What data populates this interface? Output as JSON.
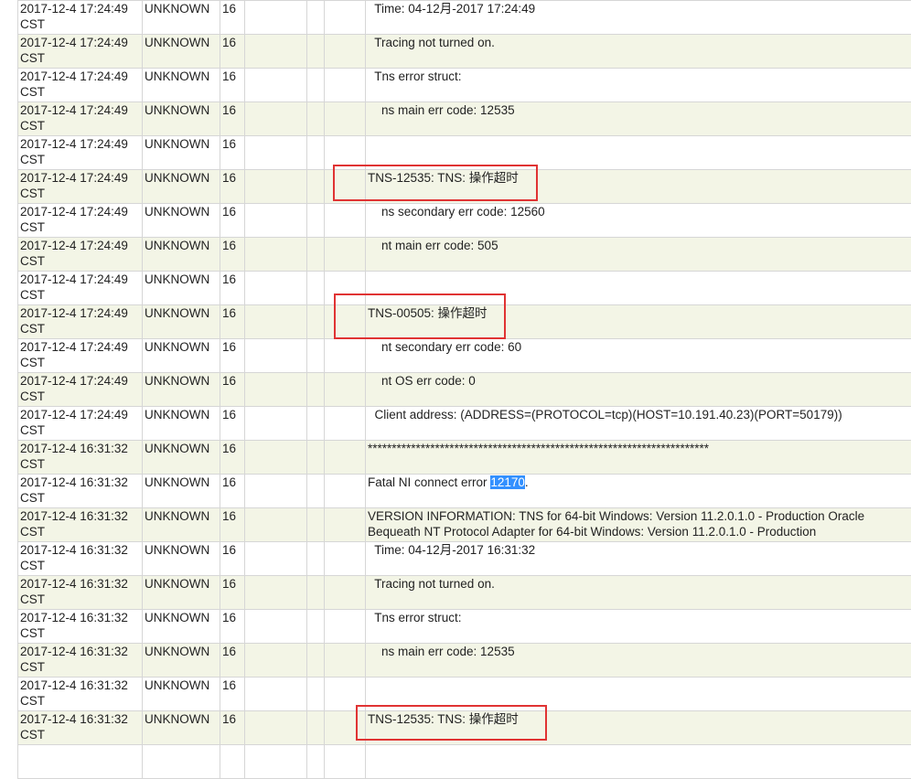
{
  "rows": [
    {
      "time": "2017-12-4 17:24:49 CST",
      "source": "UNKNOWN",
      "level": "16",
      "message": "  Time: 04-12月-2017 17:24:49"
    },
    {
      "time": "2017-12-4 17:24:49 CST",
      "source": "UNKNOWN",
      "level": "16",
      "message": "  Tracing not turned on."
    },
    {
      "time": "2017-12-4 17:24:49 CST",
      "source": "UNKNOWN",
      "level": "16",
      "message": "  Tns error struct:"
    },
    {
      "time": "2017-12-4 17:24:49 CST",
      "source": "UNKNOWN",
      "level": "16",
      "message": "    ns main err code: 12535"
    },
    {
      "time": "2017-12-4 17:24:49 CST",
      "source": "UNKNOWN",
      "level": "16",
      "message": ""
    },
    {
      "time": "2017-12-4 17:24:49 CST",
      "source": "UNKNOWN",
      "level": "16",
      "message": "TNS-12535: TNS: 操作超时"
    },
    {
      "time": "2017-12-4 17:24:49 CST",
      "source": "UNKNOWN",
      "level": "16",
      "message": "    ns secondary err code: 12560"
    },
    {
      "time": "2017-12-4 17:24:49 CST",
      "source": "UNKNOWN",
      "level": "16",
      "message": "    nt main err code: 505"
    },
    {
      "time": "2017-12-4 17:24:49 CST",
      "source": "UNKNOWN",
      "level": "16",
      "message": ""
    },
    {
      "time": "2017-12-4 17:24:49 CST",
      "source": "UNKNOWN",
      "level": "16",
      "message": "TNS-00505: 操作超时"
    },
    {
      "time": "2017-12-4 17:24:49 CST",
      "source": "UNKNOWN",
      "level": "16",
      "message": "    nt secondary err code: 60"
    },
    {
      "time": "2017-12-4 17:24:49 CST",
      "source": "UNKNOWN",
      "level": "16",
      "message": "    nt OS err code: 0"
    },
    {
      "time": "2017-12-4 17:24:49 CST",
      "source": "UNKNOWN",
      "level": "16",
      "message": "  Client address: (ADDRESS=(PROTOCOL=tcp)(HOST=10.191.40.23)(PORT=50179))"
    },
    {
      "time": "2017-12-4 16:31:32 CST",
      "source": "UNKNOWN",
      "level": "16",
      "message": "***********************************************************************"
    },
    {
      "time": "2017-12-4 16:31:32 CST",
      "source": "UNKNOWN",
      "level": "16",
      "message_prefix": "Fatal NI connect error ",
      "message_highlight": "12170",
      "message_suffix": "."
    },
    {
      "time": "2017-12-4 16:31:32 CST",
      "source": "UNKNOWN",
      "level": "16",
      "message": "  VERSION INFORMATION: TNS for 64-bit Windows: Version 11.2.0.1.0 - Production Oracle Bequeath NT Protocol Adapter for 64-bit Windows: Version 11.2.0.1.0 - Production"
    },
    {
      "time": "2017-12-4 16:31:32 CST",
      "source": "UNKNOWN",
      "level": "16",
      "message": "  Time: 04-12月-2017 16:31:32"
    },
    {
      "time": "2017-12-4 16:31:32 CST",
      "source": "UNKNOWN",
      "level": "16",
      "message": "  Tracing not turned on."
    },
    {
      "time": "2017-12-4 16:31:32 CST",
      "source": "UNKNOWN",
      "level": "16",
      "message": "  Tns error struct:"
    },
    {
      "time": "2017-12-4 16:31:32 CST",
      "source": "UNKNOWN",
      "level": "16",
      "message": "    ns main err code: 12535"
    },
    {
      "time": "2017-12-4 16:31:32 CST",
      "source": "UNKNOWN",
      "level": "16",
      "message": ""
    },
    {
      "time": "2017-12-4 16:31:32 CST",
      "source": "UNKNOWN",
      "level": "16",
      "message": "TNS-12535: TNS: 操作超时"
    }
  ],
  "colors": {
    "alt_row": "#f3f5e6",
    "annotation_box": "#e03333",
    "highlight": "#3390ff"
  }
}
